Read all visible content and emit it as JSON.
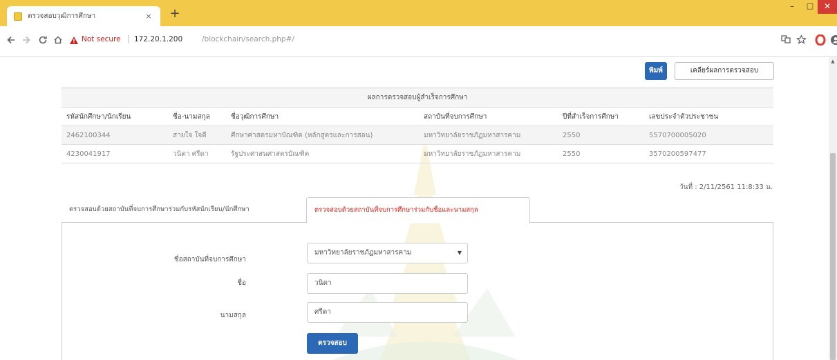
{
  "browser": {
    "tab_title": "ตรวจสอบวุฒิการศึกษา",
    "tab_close": "×",
    "new_tab": "+",
    "window_buttons": {
      "minimize": "–",
      "maximize": "□",
      "close": "✕"
    },
    "address": {
      "security_label": "Not secure",
      "separator": "|",
      "host": "172.20.1.200",
      "path": "/blockchain/search.php#/"
    },
    "icons": [
      "back-icon",
      "forward-icon",
      "reload-icon",
      "home-icon",
      "warning-icon",
      "translate-icon",
      "star-icon",
      "opera-icon",
      "profile-icon",
      "menu-icon"
    ]
  },
  "page": {
    "buttons": {
      "print": "พิมพ์",
      "back_to_list": "เคลียร์ผลการตรวจสอบ",
      "submit": "ตรวจสอบ"
    },
    "result_table": {
      "caption": "ผลการตรวจสอบผู้สำเร็จการศึกษา",
      "columns": [
        "รหัสนักศึกษา/นักเรียน",
        "ชื่อ-นามสกุล",
        "ชื่อวุฒิการศึกษา",
        "สถาบันที่จบการศึกษา",
        "ปีที่สำเร็จการศึกษา",
        "เลขประจำตัวประชาชน"
      ],
      "rows": [
        [
          "2462100344",
          "สายใจ ใจดี",
          "ศึกษาศาสตรมหาบัณฑิต (หลักสูตรและการสอน)",
          "มหาวิทยาลัยราชภัฏมหาสารคาม",
          "2550",
          "5570700005020"
        ],
        [
          "4230041917",
          "วนิดา ศรีดา",
          "รัฐประศาสนศาสตรบัณฑิต",
          "มหาวิทยาลัยราชภัฏมหาสารคาม",
          "2550",
          "3570200597477"
        ]
      ]
    },
    "date_stamp": "วันที่ : 2/11/2561 11:8:33 น.",
    "tabs": [
      {
        "label": "ตรวจสอบด้วยสถาบันที่จบการศึกษาร่วมกับรหัสนักเรียน/นักศึกษา",
        "active": false
      },
      {
        "label": "ตรวจสอบด้วยสถาบันที่จบการศึกษาร่วมกับชื่อและนามสกุล",
        "active": true
      }
    ],
    "form": {
      "institution_label": "ชื่อสถาบันที่จบการศึกษา",
      "institution_value": "มหาวิทยาลัยราชภัฏมหาสารคาม",
      "first_name_label": "ชื่อ",
      "first_name_value": "วนิดา",
      "last_name_label": "นามสกุล",
      "last_name_value": "ศรีดา"
    }
  },
  "colors": {
    "titlebar": "#f3c94a",
    "primary_button": "#2b68b5",
    "active_tab_text": "#e2231a",
    "close_button": "#d43b35"
  }
}
